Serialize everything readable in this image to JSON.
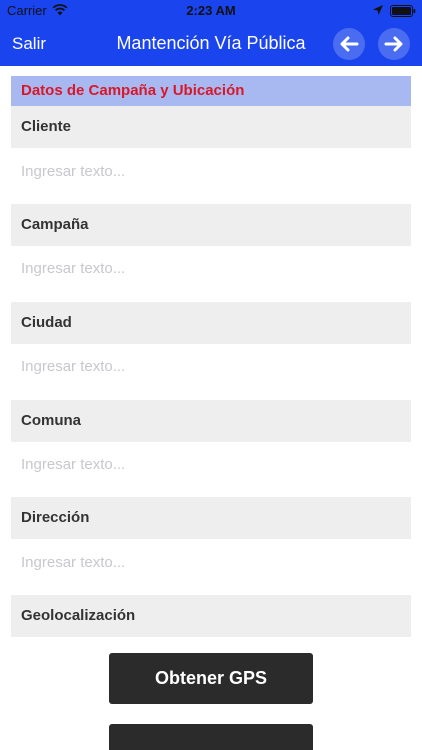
{
  "status": {
    "carrier": "Carrier",
    "time": "2:23 AM"
  },
  "nav": {
    "back_label": "Salir",
    "title": "Mantención Vía Pública",
    "prev_icon": "arrow-left-icon",
    "next_icon": "arrow-right-icon"
  },
  "section": {
    "title": "Datos de Campaña y Ubicación"
  },
  "fields": [
    {
      "label": "Cliente",
      "placeholder": "Ingresar texto...",
      "value": ""
    },
    {
      "label": "Campaña",
      "placeholder": "Ingresar texto...",
      "value": ""
    },
    {
      "label": "Ciudad",
      "placeholder": "Ingresar texto...",
      "value": ""
    },
    {
      "label": "Comuna",
      "placeholder": "Ingresar texto...",
      "value": ""
    },
    {
      "label": "Dirección",
      "placeholder": "Ingresar texto...",
      "value": ""
    }
  ],
  "geolocation": {
    "label": "Geolocalización",
    "button_label": "Obtener GPS"
  },
  "colors": {
    "nav_background": "#1a44ee",
    "section_background": "#a8b9f1",
    "section_text": "#d8182a",
    "button_background": "#2b2b2b"
  }
}
